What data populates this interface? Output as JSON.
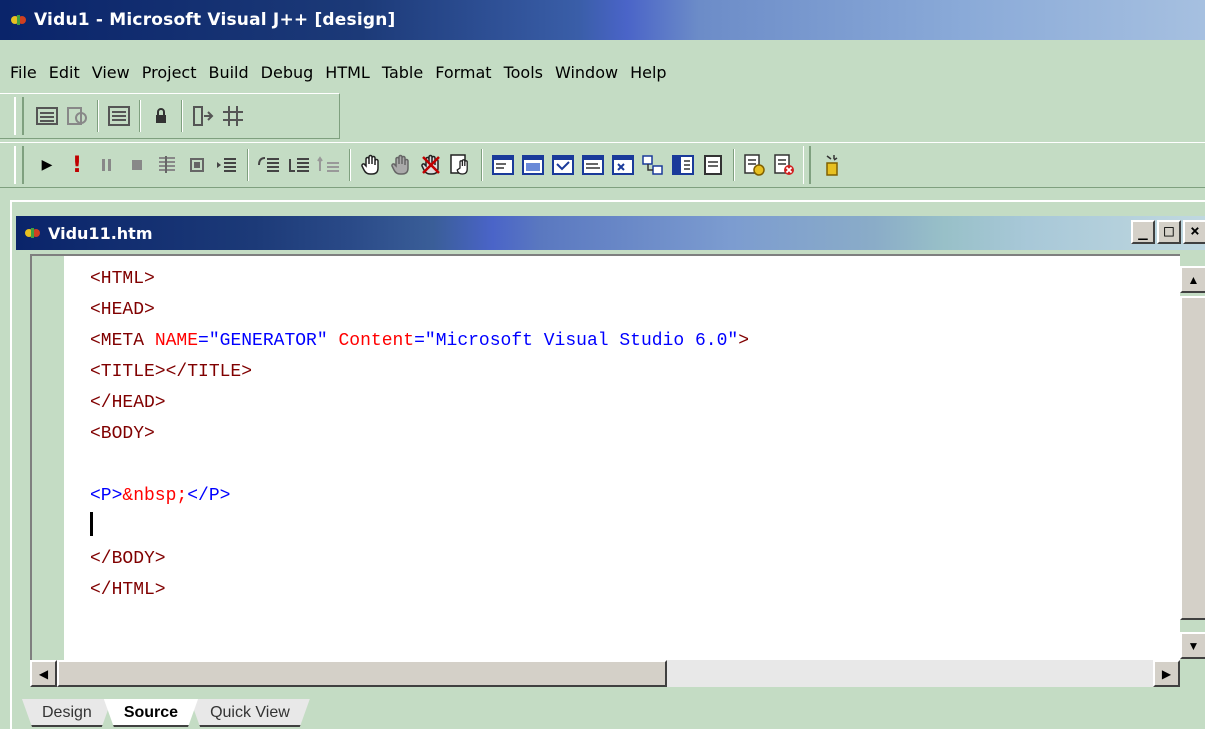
{
  "window": {
    "title": "Vidu1 - Microsoft Visual J++ [design]"
  },
  "menu": [
    "File",
    "Edit",
    "View",
    "Project",
    "Build",
    "Debug",
    "HTML",
    "Table",
    "Format",
    "Tools",
    "Window",
    "Help"
  ],
  "document": {
    "title": "Vidu11.htm",
    "code": {
      "l1": "<HTML>",
      "l2": "<HEAD>",
      "l3_tag_open": "<META ",
      "l3_attr1": "NAME",
      "l3_eq1": "=",
      "l3_val1": "\"GENERATOR\"",
      "l3_attr2": "Content",
      "l3_eq2": "=",
      "l3_val2": "\"Microsoft Visual Studio 6.0\"",
      "l3_close": ">",
      "l4": "<TITLE></TITLE>",
      "l5": "</HEAD>",
      "l6": "<BODY>",
      "l8_open": "<P>",
      "l8_entity": "&nbsp;",
      "l8_close": "</P>",
      "l10": "</BODY>",
      "l11": "</HTML>"
    },
    "view_tabs": [
      "Design",
      "Source",
      "Quick View"
    ],
    "active_tab": "Source"
  },
  "window_buttons": {
    "minimize": "_",
    "maximize": "□",
    "close": "×"
  },
  "colors": {
    "tag": "#800000",
    "attribute": "#ff0000",
    "value": "#0000ff",
    "entity": "#ff0000"
  }
}
